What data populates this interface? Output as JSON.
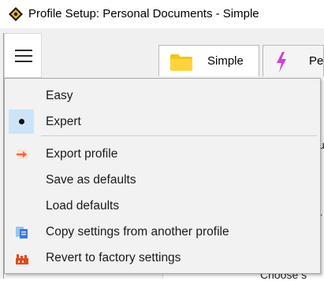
{
  "window": {
    "title": "Profile Setup: Personal Documents - Simple"
  },
  "tabs": [
    {
      "label": "Simple",
      "icon": "folder-icon",
      "color": "#f5c518"
    },
    {
      "label": "Pe",
      "icon": "lightning-icon",
      "color": "#d63cd8"
    }
  ],
  "background_text": {
    "snippet_1": "u",
    "snippet_2": "r",
    "snippet_3": "Choose s"
  },
  "menu": {
    "items": [
      {
        "label": "Easy",
        "icon": ""
      },
      {
        "label": "Expert",
        "icon": "radio-dot-icon",
        "checked": true
      },
      {
        "label": "Export profile",
        "icon": "export-arrow-icon",
        "color": "#f26b3a"
      },
      {
        "label": "Save as defaults",
        "icon": ""
      },
      {
        "label": "Load defaults",
        "icon": ""
      },
      {
        "label": "Copy settings from another profile",
        "icon": "copy-settings-icon",
        "color": "#3a7bd5"
      },
      {
        "label": "Revert to factory settings",
        "icon": "factory-icon",
        "color": "#e04a1f"
      }
    ]
  }
}
